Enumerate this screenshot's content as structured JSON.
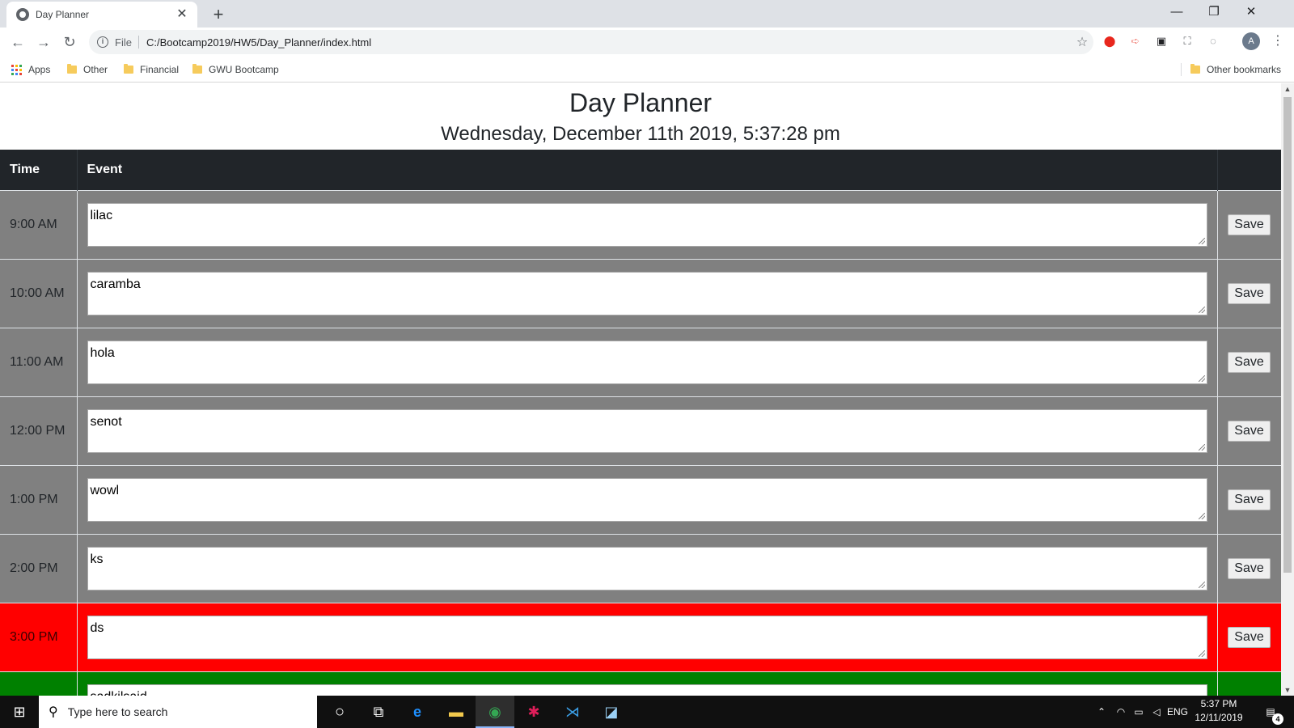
{
  "browser": {
    "tab_title": "Day Planner",
    "tab_close": "✕",
    "new_tab": "+",
    "window_controls": {
      "minimize": "—",
      "restore": "❐",
      "close": "✕"
    },
    "nav": {
      "back": "←",
      "forward": "→",
      "reload": "↻"
    },
    "address": {
      "scheme_label": "File",
      "url": "C:/Bootcamp2019/HW5/Day_Planner/index.html"
    },
    "profile_initial": "A",
    "menu": "⋮",
    "bookmarks": [
      {
        "label": "Apps",
        "icon": "apps-grid-icon"
      },
      {
        "label": "Other",
        "icon": "folder-icon"
      },
      {
        "label": "Financial",
        "icon": "folder-icon"
      },
      {
        "label": "GWU Bootcamp",
        "icon": "folder-icon"
      }
    ],
    "other_bookmarks": "Other bookmarks"
  },
  "page": {
    "title": "Day Planner",
    "datetime": "Wednesday, December 11th 2019, 5:37:28 pm",
    "table": {
      "headers": {
        "time": "Time",
        "event": "Event",
        "action": ""
      },
      "save_label": "Save",
      "rows": [
        {
          "time": "9:00 AM",
          "event": "lilac",
          "state": "past"
        },
        {
          "time": "10:00 AM",
          "event": "caramba",
          "state": "past"
        },
        {
          "time": "11:00 AM",
          "event": "hola",
          "state": "past"
        },
        {
          "time": "12:00 PM",
          "event": "senot",
          "state": "past"
        },
        {
          "time": "1:00 PM",
          "event": "wowl",
          "state": "past"
        },
        {
          "time": "2:00 PM",
          "event": "ks",
          "state": "past"
        },
        {
          "time": "3:00 PM",
          "event": "ds",
          "state": "present"
        },
        {
          "time": "",
          "event": "sadkjlsajd",
          "state": "future"
        }
      ]
    },
    "colors": {
      "past": "#808080",
      "present": "#ff0000",
      "future": "#008000",
      "header": "#212529"
    }
  },
  "taskbar": {
    "search_placeholder": "Type here to search",
    "language": "ENG",
    "time": "5:37 PM",
    "date": "12/11/2019",
    "notification_count": "4"
  }
}
